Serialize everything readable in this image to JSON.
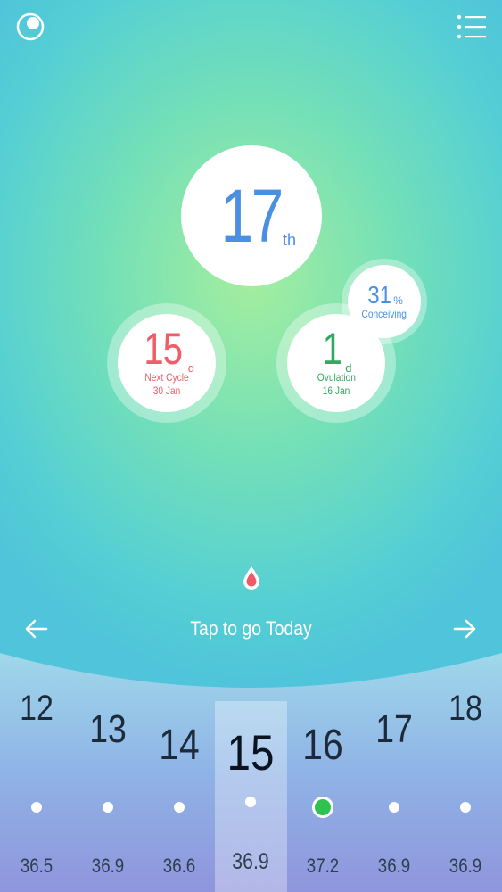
{
  "header": {
    "logo_icon": "moon-circle-icon",
    "menu_icon": "list-menu-icon"
  },
  "day": {
    "number": "17",
    "suffix": "th"
  },
  "next_cycle": {
    "value": "15",
    "unit": "d",
    "label": "Next Cycle",
    "date": "30 Jan",
    "color": "#ef5d69"
  },
  "ovulation": {
    "value": "1",
    "unit": "d",
    "label": "Ovulation",
    "date": "16 Jan",
    "color": "#33a860"
  },
  "conceiving": {
    "value": "31",
    "unit": "%",
    "label": "Conceiving",
    "color": "#4a8fe0"
  },
  "period_indicator": "blood-drop-icon",
  "nav": {
    "prev_icon": "arrow-left-icon",
    "next_icon": "arrow-right-icon",
    "today_label": "Tap to go Today"
  },
  "calendar": {
    "selected_index": 3,
    "days": [
      {
        "date": "12",
        "temp": "36.5"
      },
      {
        "date": "13",
        "temp": "36.9"
      },
      {
        "date": "14",
        "temp": "36.6"
      },
      {
        "date": "15",
        "temp": "36.9"
      },
      {
        "date": "16",
        "temp": "37.2",
        "ovulation": true
      },
      {
        "date": "17",
        "temp": "36.9"
      },
      {
        "date": "18",
        "temp": "36.9"
      }
    ]
  }
}
